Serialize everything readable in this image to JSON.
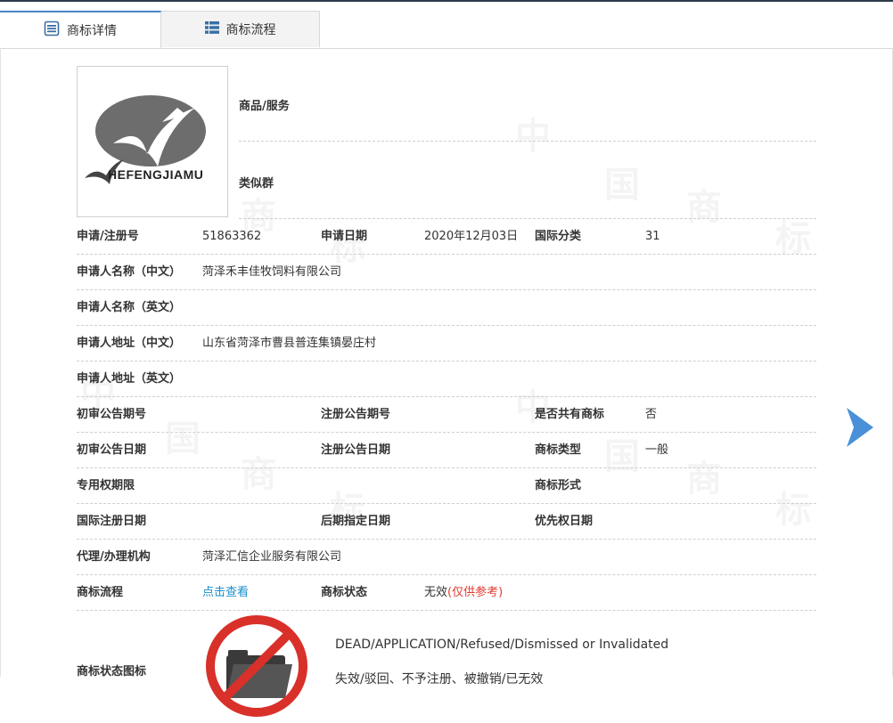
{
  "tabs": [
    {
      "label": "商标详情",
      "icon": "document-icon",
      "active": true
    },
    {
      "label": "商标流程",
      "icon": "list-icon",
      "active": false
    }
  ],
  "watermark": [
    "中",
    "国",
    "商",
    "标"
  ],
  "logo": {
    "text": "HEFENGJIAMU"
  },
  "goods": {
    "label": "商品/服务"
  },
  "similar": {
    "label": "类似群"
  },
  "rows": {
    "r1": {
      "l1": "申请/注册号",
      "v1": "51863362",
      "l2": "申请日期",
      "v2": "2020年12月03日",
      "l3": "国际分类",
      "v3": "31"
    },
    "r2": {
      "l1": "申请人名称（中文）",
      "v1": "菏泽禾丰佳牧饲料有限公司"
    },
    "r3": {
      "l1": "申请人名称（英文）",
      "v1": ""
    },
    "r4": {
      "l1": "申请人地址（中文）",
      "v1": "山东省菏泽市曹县普连集镇晏庄村"
    },
    "r5": {
      "l1": "申请人地址（英文）",
      "v1": ""
    },
    "r6": {
      "l1": "初审公告期号",
      "l2": "注册公告期号",
      "l3": "是否共有商标",
      "v3": "否"
    },
    "r7": {
      "l1": "初审公告日期",
      "l2": "注册公告日期",
      "l3": "商标类型",
      "v3": "一般"
    },
    "r8": {
      "l1": "专用权期限",
      "l3": "商标形式"
    },
    "r9": {
      "l1": "国际注册日期",
      "l2": "后期指定日期",
      "l3": "优先权日期"
    },
    "r10": {
      "l1": "代理/办理机构",
      "v1": "菏泽汇信企业服务有限公司"
    },
    "r11": {
      "l1": "商标流程",
      "link": "点击查看",
      "l2": "商标状态",
      "v2": "无效",
      "note": "(仅供参考)"
    }
  },
  "status": {
    "label": "商标状态图标",
    "en": "DEAD/APPLICATION/Refused/Dismissed or Invalidated",
    "cn": "失效/驳回、不予注册、被撤销/已无效"
  },
  "colors": {
    "accent": "#4a86c8",
    "link": "#1a8fc7",
    "warning": "#e03a2f",
    "arrow": "#4a90d9"
  }
}
